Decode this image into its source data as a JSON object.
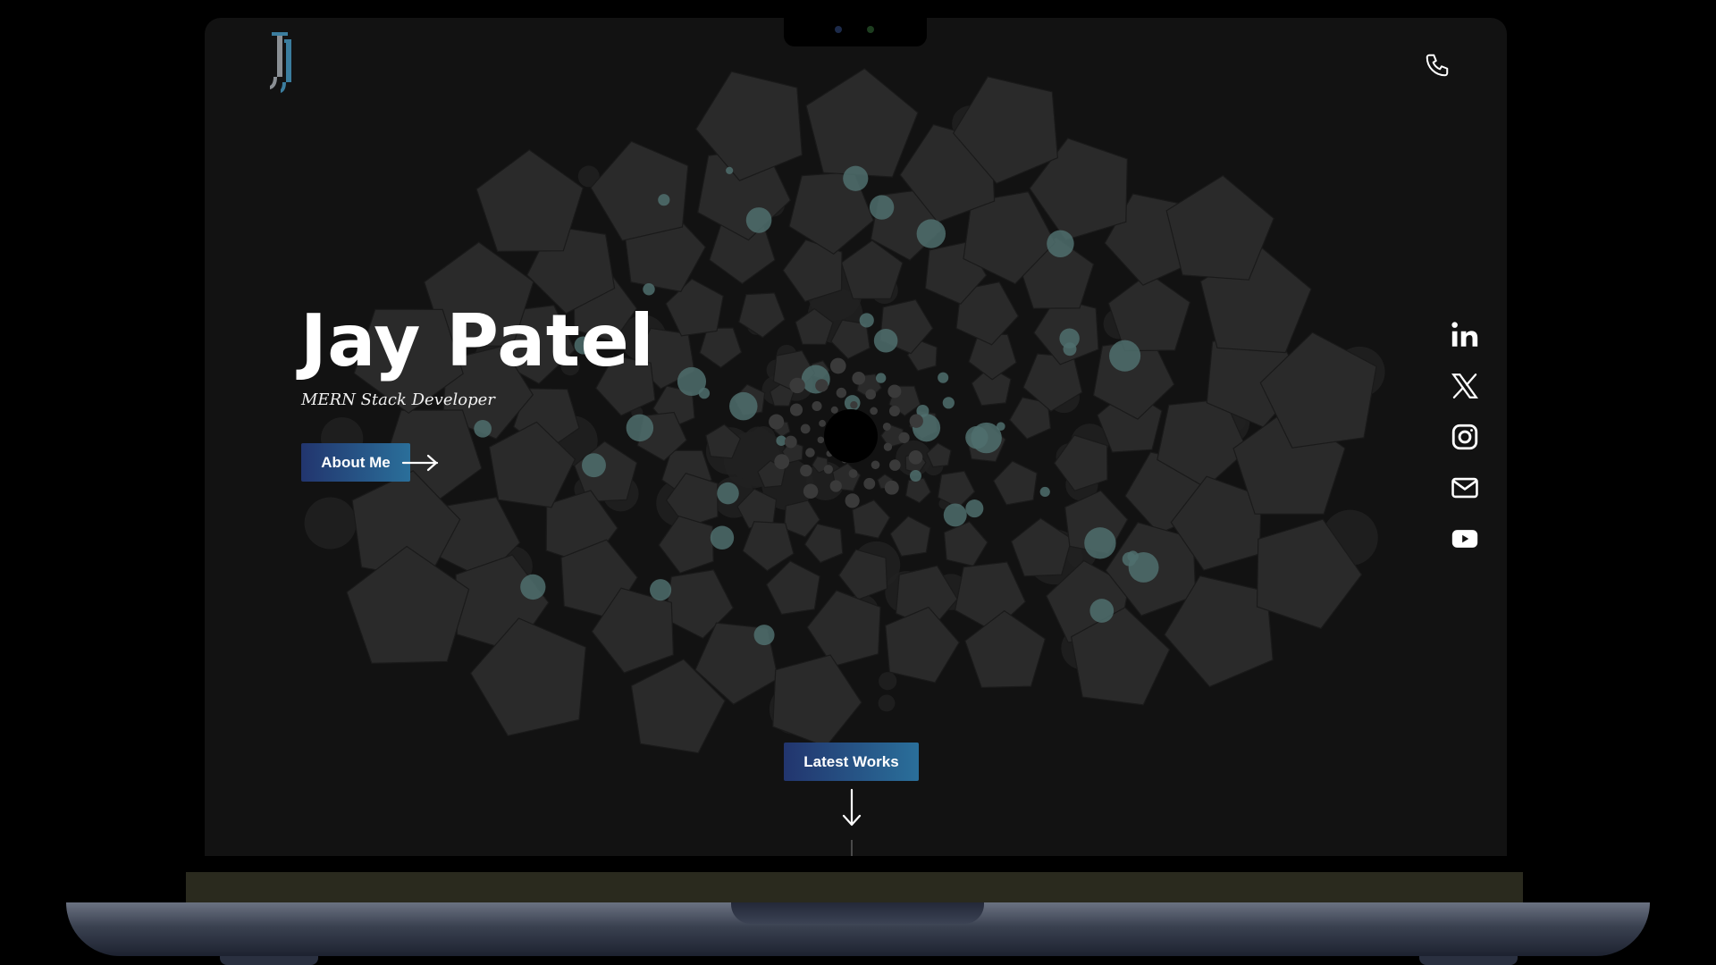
{
  "header": {
    "logo_icon": "jp-monogram-logo",
    "phone_icon": "phone-icon"
  },
  "hero": {
    "name": "Jay Patel",
    "title": "MERN Stack Developer",
    "about_label": "About Me",
    "about_icon": "arrow-right-icon"
  },
  "social": [
    {
      "name": "linkedin-icon"
    },
    {
      "name": "x-twitter-icon"
    },
    {
      "name": "instagram-icon"
    },
    {
      "name": "mail-icon"
    },
    {
      "name": "youtube-icon"
    }
  ],
  "works": {
    "label": "Latest Works",
    "icon": "arrow-down-icon"
  },
  "colors": {
    "background": "#121212",
    "button_gradient_start": "#22356e",
    "button_gradient_end": "#2a6f9a",
    "shape_fill": "#2a2a2a",
    "accent_circle": "#4f6f6d",
    "text": "#ffffff"
  }
}
